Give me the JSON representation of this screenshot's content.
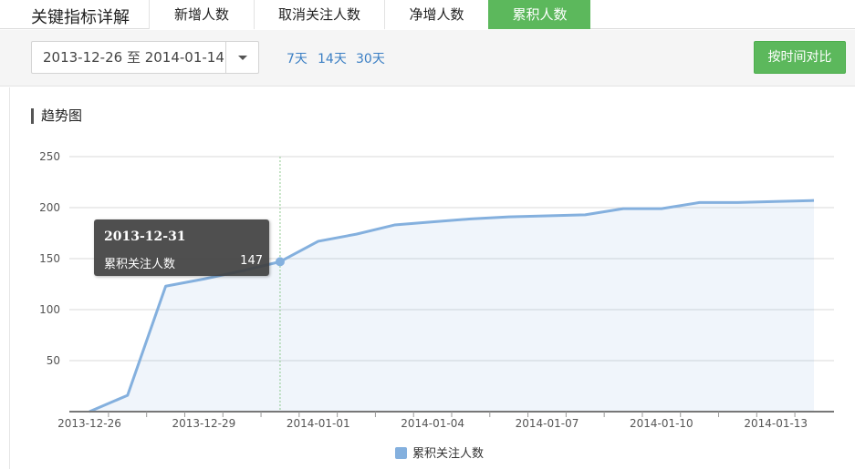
{
  "header": {
    "title": "关键指标详解",
    "tabs": [
      {
        "label": "新增人数"
      },
      {
        "label": "取消关注人数"
      },
      {
        "label": "净增人数"
      },
      {
        "label": "累积人数"
      }
    ],
    "active_tab": 3
  },
  "toolbar": {
    "date_range": "2013-12-26 至 2014-01-14",
    "quick_ranges": [
      "7天",
      "14天",
      "30天"
    ],
    "compare_label": "按时间对比"
  },
  "section": {
    "title": "趋势图"
  },
  "colors": {
    "accent": "#5cb85c",
    "series": "#84b0de",
    "link": "#3b7fc4"
  },
  "tooltip": {
    "date": "2013-12-31",
    "series_name": "累积关注人数",
    "value": "147"
  },
  "chart_data": {
    "type": "area",
    "x": [
      "2013-12-26",
      "2013-12-27",
      "2013-12-28",
      "2013-12-29",
      "2013-12-30",
      "2013-12-31",
      "2014-01-01",
      "2014-01-02",
      "2014-01-03",
      "2014-01-04",
      "2014-01-05",
      "2014-01-06",
      "2014-01-07",
      "2014-01-08",
      "2014-01-09",
      "2014-01-10",
      "2014-01-11",
      "2014-01-12",
      "2014-01-13",
      "2014-01-14"
    ],
    "series": [
      {
        "name": "累积关注人数",
        "values": [
          0,
          16,
          123,
          130,
          138,
          147,
          167,
          174,
          183,
          186,
          189,
          191,
          192,
          193,
          199,
          199,
          205,
          205,
          206,
          207
        ]
      }
    ],
    "yticks": [
      50,
      100,
      150,
      200,
      250
    ],
    "ylim": [
      0,
      250
    ],
    "xtick_labels": [
      "2013-12-26",
      "2013-12-29",
      "2014-01-01",
      "2014-01-04",
      "2014-01-07",
      "2014-01-10",
      "2014-01-13"
    ],
    "xtick_every": 3,
    "highlight_index": 5,
    "legend_position": "bottom-center",
    "grid": true
  }
}
